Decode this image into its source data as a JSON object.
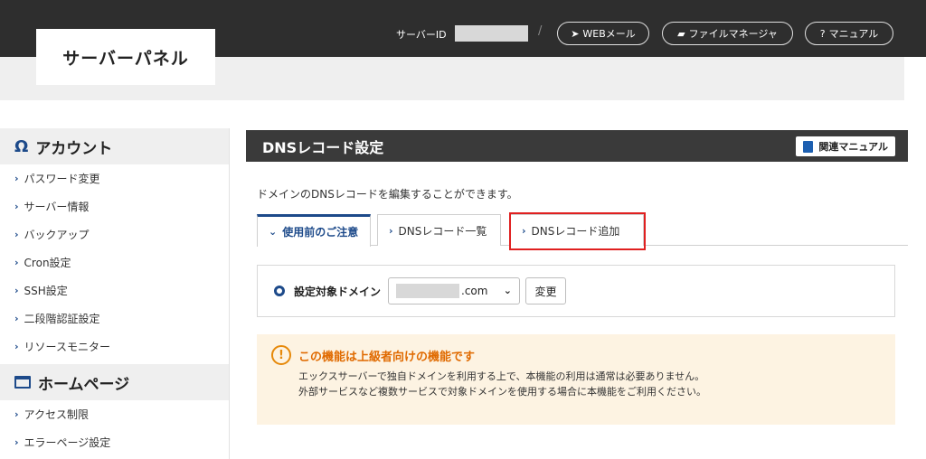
{
  "header": {
    "logo": "サーバーパネル",
    "server_id_label": "サーバーID",
    "separator": "/",
    "web_mail": "WEBメール",
    "file_manager": "ファイルマネージャ",
    "manual": "マニュアル"
  },
  "sidebar": {
    "account_heading": "アカウント",
    "account_items": [
      "パスワード変更",
      "サーバー情報",
      "バックアップ",
      "Cron設定",
      "SSH設定",
      "二段階認証設定",
      "リソースモニター"
    ],
    "homepage_heading": "ホームページ",
    "homepage_items": [
      "アクセス制限",
      "エラーページ設定"
    ]
  },
  "main": {
    "title": "DNSレコード設定",
    "related_manual": "関連マニュアル",
    "description": "ドメインのDNSレコードを編集することができます。",
    "tabs": [
      "使用前のご注意",
      "DNSレコード一覧",
      "DNSレコード追加"
    ],
    "domain_label": "設定対象ドメイン",
    "domain_suffix": ".com",
    "change_button": "変更",
    "warning_title": "この機能は上級者向けの機能です",
    "warning_lines": [
      "エックスサーバーで独自ドメインを利用する上で、本機能の利用は通常は必要ありません。",
      "外部サービスなど複数サービスで対象ドメインを使用する場合に本機能をご利用ください。"
    ]
  },
  "colors": {
    "header_bg": "#2e2e2e",
    "accent_blue": "#1d4a8a",
    "warning_orange": "#e06a00",
    "highlight_red": "#e02020"
  }
}
